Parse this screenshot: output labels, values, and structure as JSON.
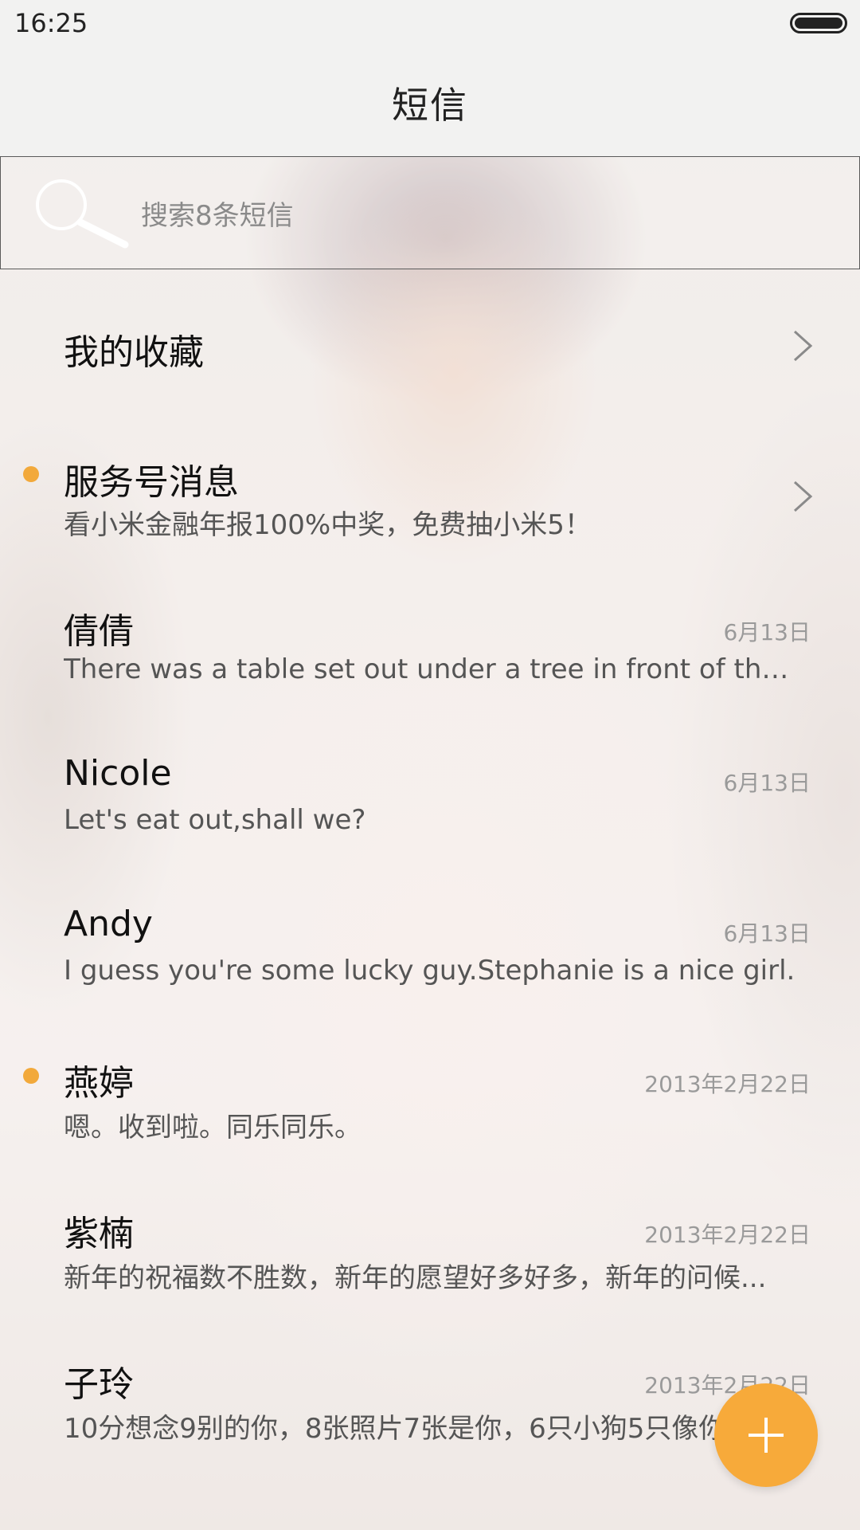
{
  "status_bar": {
    "time": "16:25"
  },
  "header": {
    "title": "短信"
  },
  "search": {
    "placeholder": "搜索8条短信"
  },
  "accent_color": "#f2a93b",
  "fab_color": "#f7aa3a",
  "conversations": [
    {
      "name": "我的收藏",
      "preview": "",
      "date": "",
      "unread": false,
      "chevron": true
    },
    {
      "name": "服务号消息",
      "preview": "看小米金融年报100%中奖，免费抽小米5！",
      "date": "",
      "unread": true,
      "chevron": true
    },
    {
      "name": "倩倩",
      "preview": "There was a table set out under a tree in front of the ho...",
      "date": "6月13日",
      "unread": false,
      "chevron": false
    },
    {
      "name": "Nicole",
      "preview": "Let's eat out,shall we?",
      "date": "6月13日",
      "unread": false,
      "chevron": false
    },
    {
      "name": "Andy",
      "preview": "I guess you're some lucky guy.Stephanie is a nice girl.",
      "date": "6月13日",
      "unread": false,
      "chevron": false
    },
    {
      "name": "燕婷",
      "preview": "嗯。收到啦。同乐同乐。",
      "date": "2013年2月22日",
      "unread": true,
      "chevron": false
    },
    {
      "name": "紫楠",
      "preview": "新年的祝福数不胜数，新年的愿望好多好多，新年的问候...",
      "date": "2013年2月22日",
      "unread": false,
      "chevron": false
    },
    {
      "name": "子玲",
      "preview": "10分想念9别的你，8张照片7张是你，6只小狗5只像你",
      "date": "2013年2月22日",
      "unread": false,
      "chevron": false
    }
  ],
  "icons": {
    "search": "search-icon",
    "chevron": "chevron-right-icon",
    "fab": "plus-icon",
    "battery": "battery-icon",
    "unread": "unread-dot"
  }
}
